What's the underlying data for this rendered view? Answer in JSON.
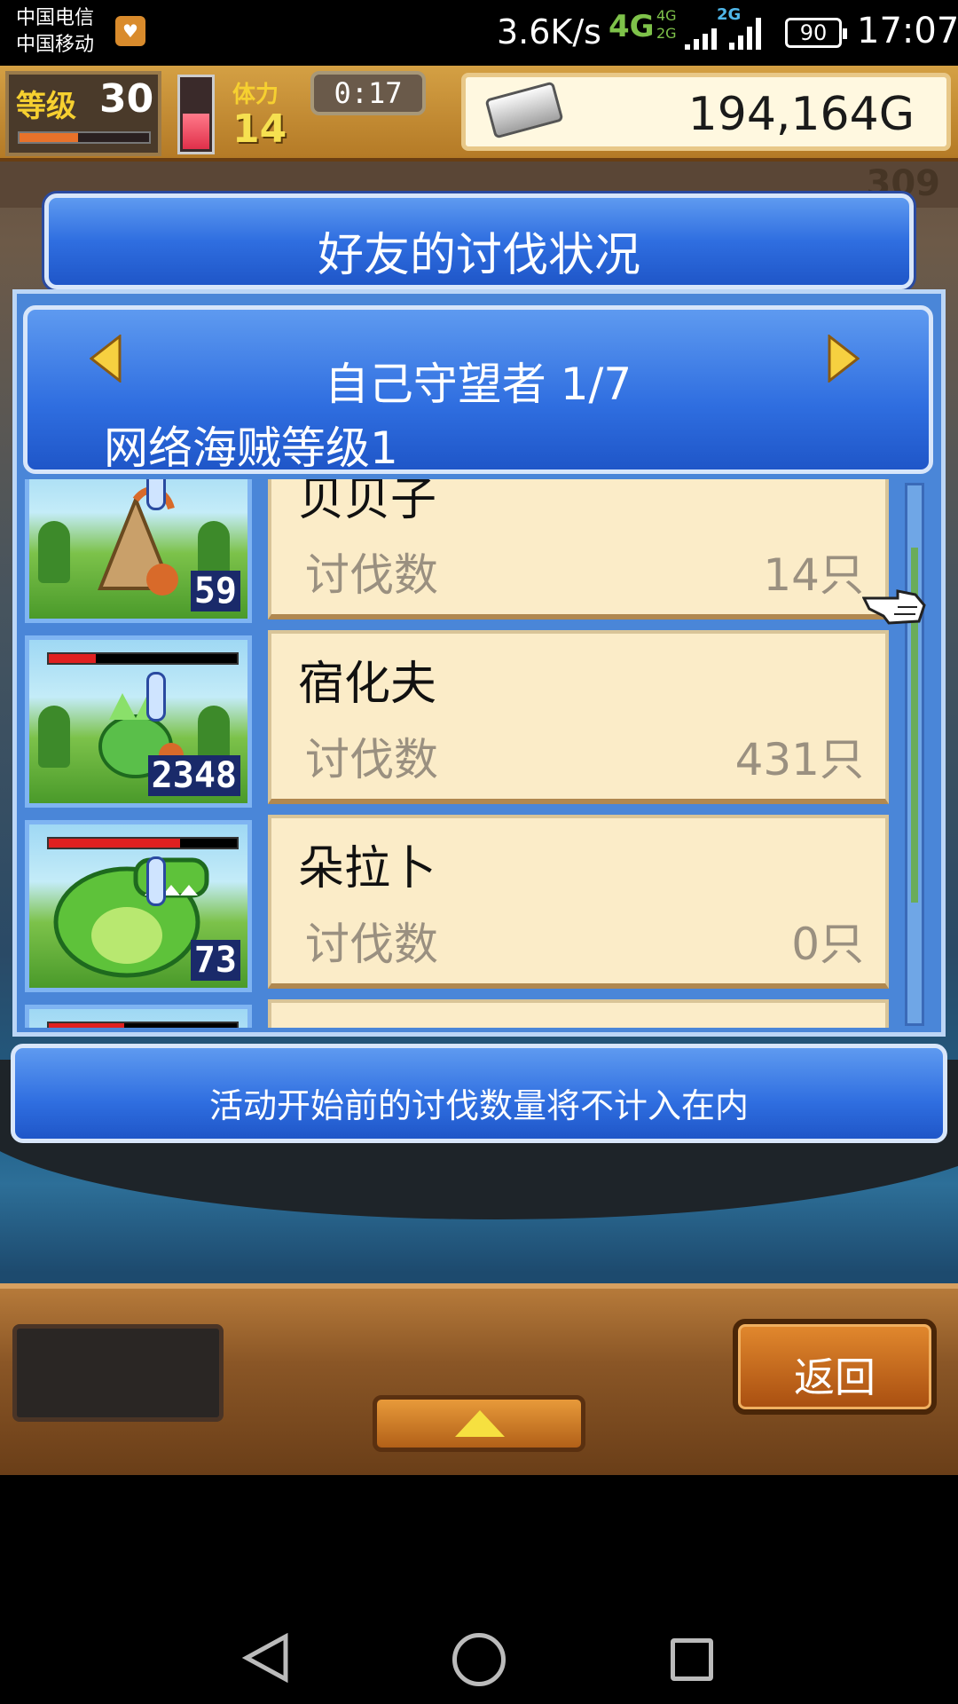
{
  "status_bar": {
    "carrier_1": "中国电信",
    "carrier_2": "中国移动",
    "speed": "3.6K/s",
    "network": "4G",
    "network_small_top": "4G",
    "network_small_bottom": "2G",
    "network_secondary": "2G",
    "battery": "90",
    "time": "17:07"
  },
  "hud": {
    "level_label": "等级",
    "level_value": "30",
    "level_progress": 0.45,
    "stamina_level": 0.55,
    "stamina_label": "体力",
    "stamina_value": "14",
    "timer": "0:17",
    "money": "194,164G",
    "count": "309"
  },
  "dialog": {
    "title": "好友的讨伐状况",
    "header_title": "自己守望者 1/7",
    "header_subtitle": "网络海贼等级1",
    "rows": [
      {
        "name": "贝贝子",
        "label": "讨伐数",
        "value": "14只",
        "thumb_number": "59",
        "hp": null
      },
      {
        "name": "宿化夫",
        "label": "讨伐数",
        "value": "431只",
        "thumb_number": "2348",
        "hp": 0.25
      },
      {
        "name": "朵拉卜",
        "label": "讨伐数",
        "value": "0只",
        "thumb_number": "73",
        "hp": 0.7
      },
      {
        "name": "",
        "label": "",
        "value": "",
        "thumb_number": "",
        "hp": 0.4
      }
    ],
    "notice": "活动开始前的讨伐数量将不计入在内"
  },
  "bottom": {
    "back_label": "返回"
  },
  "icons": {
    "prev": "chevron-left-icon",
    "next": "chevron-right-icon",
    "pointer": "hand-pointer-icon",
    "up": "triangle-up-icon"
  },
  "colors": {
    "panel_blue": "#2f6ee0",
    "card_cream": "#fbecc8",
    "gold": "#f6d030",
    "button_orange": "#e2892e"
  }
}
